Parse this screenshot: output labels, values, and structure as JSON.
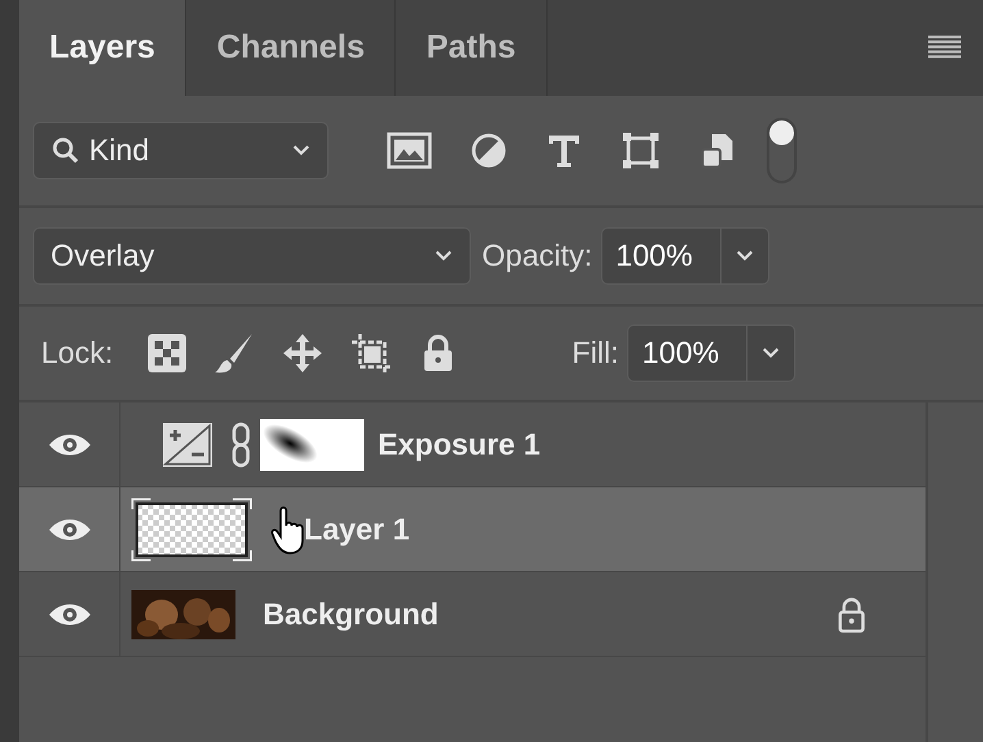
{
  "tabs": [
    {
      "label": "Layers",
      "selected": true
    },
    {
      "label": "Channels",
      "selected": false
    },
    {
      "label": "Paths",
      "selected": false
    }
  ],
  "filter": {
    "kind": "Kind",
    "on": true
  },
  "blend": {
    "mode": "Overlay",
    "opacity_label": "Opacity:",
    "opacity": "100%"
  },
  "lock": {
    "label": "Lock:",
    "fill_label": "Fill:",
    "fill": "100%"
  },
  "layers": [
    {
      "name": "Exposure 1",
      "kind": "adjustment",
      "visible": true,
      "selected": false,
      "locked": false
    },
    {
      "name": "Layer 1",
      "kind": "pixel",
      "visible": true,
      "selected": true,
      "locked": false
    },
    {
      "name": "Background",
      "visible": true,
      "selected": false,
      "locked": true
    }
  ]
}
